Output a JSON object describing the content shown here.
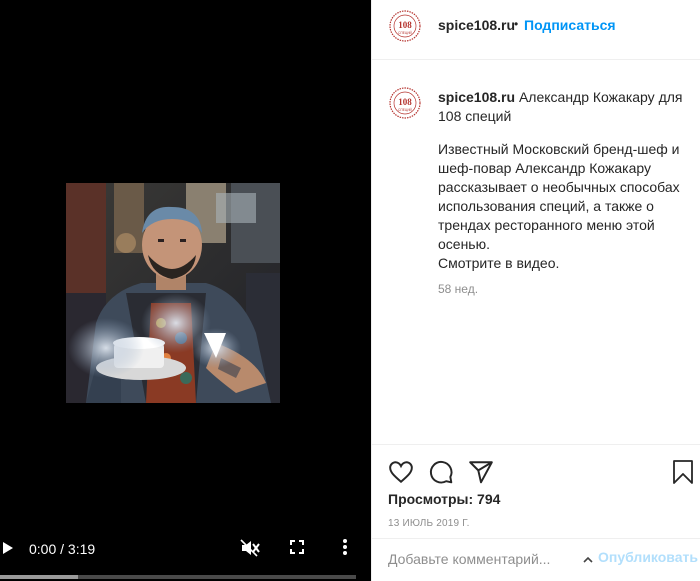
{
  "video": {
    "time_label": "0:00 / 3:19",
    "progress_buffered": 0.22,
    "progress_played": 0.0
  },
  "header": {
    "username": "spice108.ru",
    "separator": "•",
    "follow_label": "Подписаться"
  },
  "brand": {
    "logo_text_top": "108",
    "logo_text_bottom": "СПЕЦИЙ",
    "logo_color": "#b5332e"
  },
  "caption": {
    "username": "spice108.ru",
    "title": "Александр Кожакару для 108 специй",
    "body": "Известный Московский бренд-шеф и шеф-повар Александр Кожакару рассказывает о необычных способах использования специй, а также о трендах ресторанного меню этой осенью.",
    "cta": "Смотрите в видео.",
    "age": "58 нед."
  },
  "actions": {
    "like_icon": "heart-icon",
    "comment_icon": "comment-icon",
    "share_icon": "share-icon",
    "save_icon": "bookmark-icon",
    "views_label": "Просмотры: 794",
    "date": "13 ИЮЛЬ 2019 Г."
  },
  "comment_bar": {
    "placeholder": "Добавьте комментарий...",
    "publish_label": "Опубликовать"
  },
  "colors": {
    "accent": "#0095f6",
    "publish_disabled": "#b2dffc",
    "muted": "#8e8e8e",
    "border": "#efefef"
  }
}
